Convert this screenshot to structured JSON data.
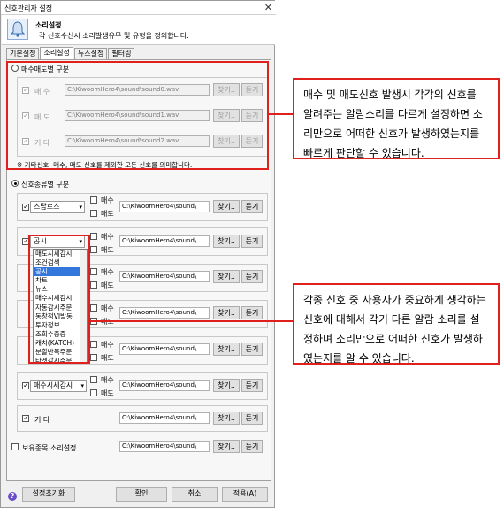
{
  "window": {
    "title": "신호관리자 설정",
    "close_glyph": "✕"
  },
  "header": {
    "title": "소리설정",
    "description": "각 신호수신시 소리발생유무 및 유형을 정의합니다."
  },
  "tabs": [
    "기본설정",
    "소리설정",
    "뉴스설정",
    "필터링"
  ],
  "buysell_section": {
    "label": "매수매도별 구분",
    "rows": [
      {
        "label": "매  수",
        "path": "C:\\KiwoomHero4\\sound\\sound0.wav"
      },
      {
        "label": "매  도",
        "path": "C:\\KiwoomHero4\\sound\\sound1.wav"
      },
      {
        "label": "기  타",
        "path": "C:\\KiwoomHero4\\sound\\sound2.wav"
      }
    ],
    "note": "※ 기타신호: 매수, 매도 신호를 제외한 모든 신호를 의미합니다."
  },
  "type_section": {
    "label": "신호종류별 구분",
    "rows": [
      {
        "combo": "스탑로스",
        "path": "C:\\KiwoomHero4\\sound\\"
      },
      {
        "combo": "공시",
        "path": "C:\\KiwoomHero4\\sound\\"
      },
      {
        "combo": "",
        "path": "C:\\KiwoomHero4\\sound\\"
      },
      {
        "combo": "",
        "path": "C:\\KiwoomHero4\\sound\\"
      },
      {
        "combo": "",
        "path": "C:\\KiwoomHero4\\sound\\"
      },
      {
        "combo": "매수시세감시",
        "path": "C:\\KiwoomHero4\\sound\\"
      }
    ],
    "other_label": "기  타",
    "other_path": "C:\\KiwoomHero4\\sound\\",
    "buy": "매수",
    "sell": "매도"
  },
  "dropdown_items": [
    "매도시세감시",
    "조건검색",
    "공시",
    "차트",
    "뉴스",
    "매수시세감시",
    "자동감시주문",
    "동창적VI발동",
    "투자정보",
    "조회수증증",
    "캐치(KATCH)",
    "분할반복주문",
    "타겟감시주문"
  ],
  "dropdown_selected": "공시",
  "buttons": {
    "find": "찾기..",
    "listen": "듣기",
    "reset": "설정초기화",
    "ok": "확인",
    "cancel": "취소",
    "apply": "적용(A)"
  },
  "holdings_label": "보유종목 소리설정",
  "callouts": {
    "top": "매수 및 매도신호 발생시 각각의 신호를 알려주는 알람소리를 다르게 설정하면 소리만으로 어떠한 신호가 발생하였는지를 빠르게 판단할 수 있습니다.",
    "bottom": "각종 신호 중 사용자가 중요하게 생각하는 신호에 대해서 각기 다른 알람 소리를 설정하며 소리만으로 어떠한 신호가 발생하였는지를 알 수 있습니다."
  },
  "colors": {
    "highlight": "#e0201c",
    "selection": "#3377dd"
  },
  "icons": {
    "bell": "bell-icon",
    "help": "help-icon"
  }
}
